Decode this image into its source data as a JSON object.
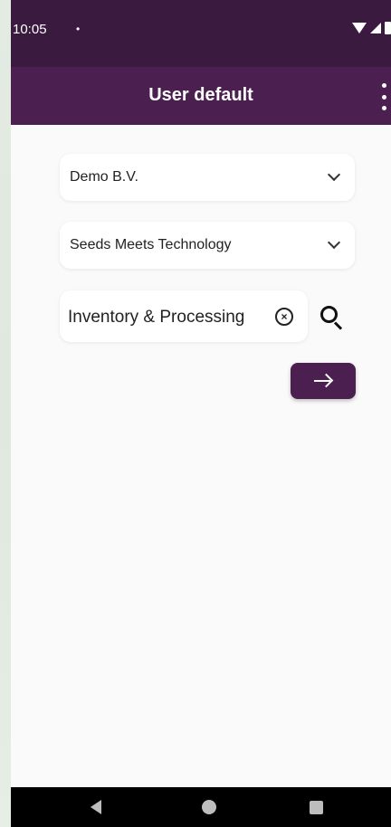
{
  "status_bar": {
    "time": "10:05",
    "dot": "•"
  },
  "app_bar": {
    "title": "User default"
  },
  "form": {
    "company_select": {
      "value": "Demo B.V."
    },
    "division_select": {
      "value": "Seeds Meets Technology"
    },
    "search": {
      "value": "Inventory & Processing",
      "clear_symbol": "×"
    }
  },
  "colors": {
    "status_bar": "#3a1a3f",
    "app_bar": "#4b2050",
    "accent_button": "#4b2050",
    "background": "#fafafa"
  },
  "icons": {
    "more": "more-vert-icon",
    "chevron": "chevron-down-icon",
    "clear": "clear-circle-icon",
    "search": "search-icon",
    "arrow": "arrow-right-icon"
  }
}
